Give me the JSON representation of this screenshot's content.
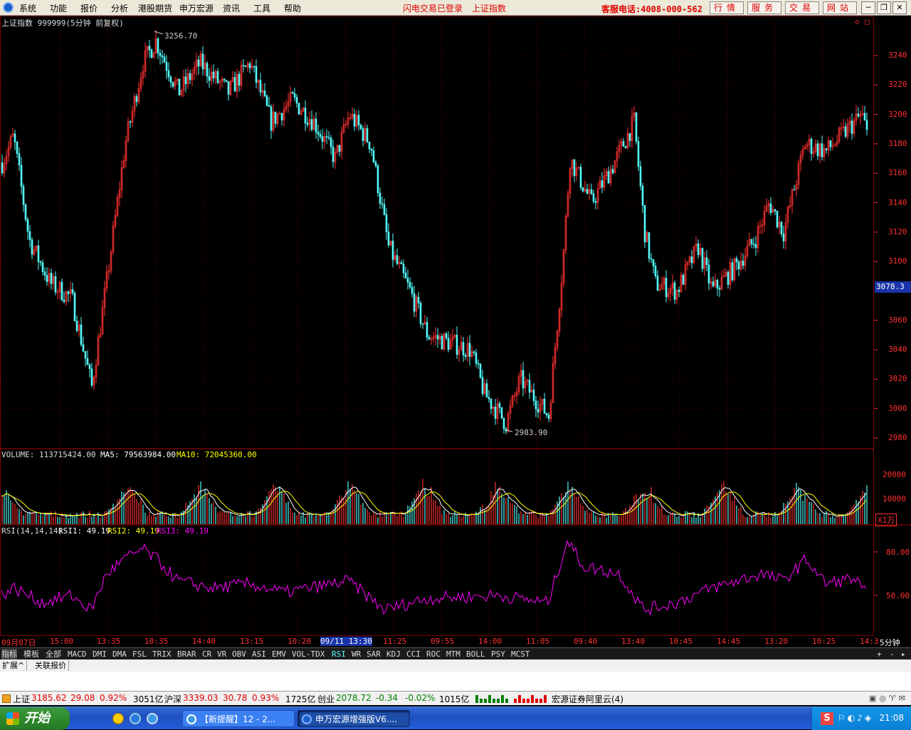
{
  "menu": {
    "items": [
      "系统",
      "功能",
      "报价",
      "分析",
      "港股期货",
      "申万宏源",
      "资讯",
      "工具",
      "帮助"
    ],
    "status_login": "闪电交易已登录",
    "status_index": "上证指数",
    "hotline": "客服电话:4008-000-562",
    "nav_buttons": [
      "行情",
      "服务",
      "交易",
      "网站"
    ],
    "window_buttons": [
      "─",
      "❐",
      "✕"
    ]
  },
  "chart": {
    "header": "上证指数 999999(5分钟 前复权)",
    "price_axis": [
      "3240",
      "3220",
      "3200",
      "3180",
      "3160",
      "3140",
      "3120",
      "3100",
      "3060",
      "3040",
      "3020",
      "3000",
      "2980"
    ],
    "current_price_label": "3078.3",
    "high_label": "3256.70",
    "low_label": "2983.90",
    "top_right_icons": [
      "◇",
      "□"
    ]
  },
  "volume": {
    "label": "VOLUME: 113715424.00",
    "ma5": "MA5: 79563984.00",
    "ma10": "MA10: 72045360.00",
    "axis": [
      "20000",
      "10000"
    ],
    "unit": "X1万"
  },
  "rsi": {
    "label": "RSI(14,14,14)",
    "rsi1": "RSI1: 49.19",
    "rsi2": "RSI2: 49.19",
    "rsi3": "RSI3: 49.19",
    "axis": [
      "80.00",
      "50.00"
    ]
  },
  "time_axis": {
    "labels": [
      "09月07日",
      "15:00",
      "13:35",
      "10:35",
      "14:40",
      "13:15",
      "10:20",
      "09/11 13:30",
      "11:25",
      "09:55",
      "14:00",
      "11:05",
      "09:40",
      "13:40",
      "10:45",
      "14:45",
      "13:20",
      "10:25",
      "14:3"
    ],
    "period": "5分钟"
  },
  "indicator_tabs": [
    "指标",
    "模板",
    "全部",
    "MACD",
    "DMI",
    "DMA",
    "FSL",
    "TRIX",
    "BRAR",
    "CR",
    "VR",
    "OBV",
    "ASI",
    "EMV",
    "VOL-TDX",
    "RSI",
    "WR",
    "SAR",
    "KDJ",
    "CCI",
    "ROC",
    "MTM",
    "BOLL",
    "PSY",
    "MCST"
  ],
  "indicator_controls": [
    "+",
    "-",
    "▸"
  ],
  "sub_tabs": [
    "扩展^",
    "关联报价"
  ],
  "quotes": {
    "sh_name": "上证",
    "sh_value": "3185.62",
    "sh_change": "29.08",
    "sh_pct": "0.92%",
    "sh_amount": "3051亿",
    "hs_name": "沪深",
    "hs_value": "3339.03",
    "hs_change": "30.78",
    "hs_pct": "0.93%",
    "hs_amount": "1725亿",
    "cy_name": "创业",
    "cy_value": "2078.72",
    "cy_change": "-0.34",
    "cy_pct": "-0.02%",
    "cy_amount": "1015亿",
    "broker": "宏源证券阿里云(4)"
  },
  "taskbar": {
    "start": "开始",
    "tasks": [
      "【新提醒】12 - 2...",
      "申万宏源增强版V6...."
    ],
    "clock": "21:08"
  },
  "colors": {
    "up": "#ff3232",
    "down": "#54fcfc",
    "grid": "#800000",
    "volume_ma5": "#ffffff",
    "volume_ma10": "#ffff00",
    "rsi": "#ff00ff"
  }
}
